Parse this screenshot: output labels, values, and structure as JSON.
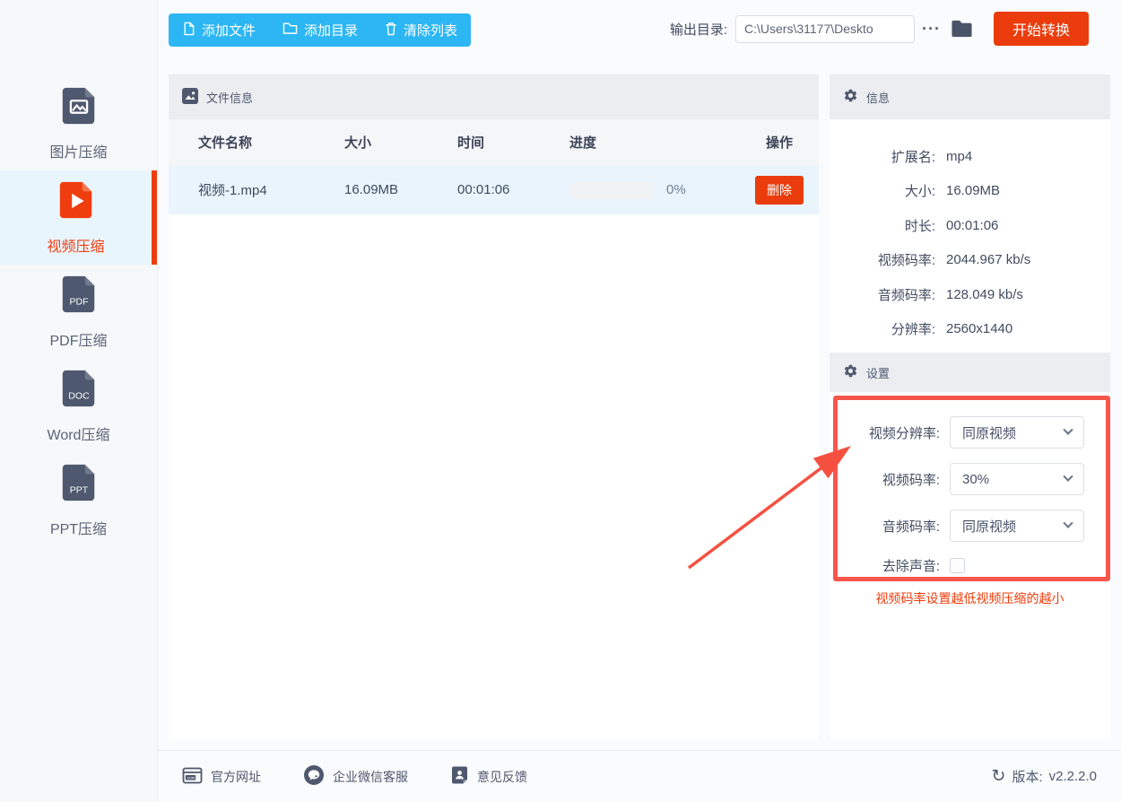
{
  "toolbar": {
    "add_file": "添加文件",
    "add_dir": "添加目录",
    "clear_list": "清除列表",
    "output_label": "输出目录:",
    "output_path": "C:\\Users\\31177\\Deskto",
    "more": "···",
    "start": "开始转换"
  },
  "sidebar": {
    "items": [
      {
        "label": "图片压缩"
      },
      {
        "label": "视频压缩"
      },
      {
        "label": "PDF压缩"
      },
      {
        "label": "Word压缩"
      },
      {
        "label": "PPT压缩"
      }
    ],
    "badges": {
      "pdf": "PDF",
      "doc": "DOC",
      "ppt": "PPT"
    }
  },
  "file_table": {
    "title": "文件信息",
    "headers": [
      "文件名称",
      "大小",
      "时间",
      "进度",
      "操作"
    ],
    "rows": [
      {
        "name": "视频-1.mp4",
        "size": "16.09MB",
        "time": "00:01:06",
        "progress": "0%",
        "action": "删除"
      }
    ]
  },
  "info_panel": {
    "title": "信息",
    "fields": [
      {
        "label": "扩展名:",
        "value": "mp4"
      },
      {
        "label": "大小:",
        "value": "16.09MB"
      },
      {
        "label": "时长:",
        "value": "00:01:06"
      },
      {
        "label": "视频码率:",
        "value": "2044.967 kb/s"
      },
      {
        "label": "音频码率:",
        "value": "128.049 kb/s"
      },
      {
        "label": "分辨率:",
        "value": "2560x1440"
      }
    ]
  },
  "settings_panel": {
    "title": "设置",
    "fields": [
      {
        "label": "视频分辨率:",
        "value": "同原视频"
      },
      {
        "label": "视频码率:",
        "value": "30%"
      },
      {
        "label": "音频码率:",
        "value": "同原视频"
      }
    ],
    "checkbox_label": "去除声音:",
    "checkbox_checked": false,
    "tip": "视频码率设置越低视频压缩的越小"
  },
  "footer": {
    "links": [
      {
        "label": "官方网址"
      },
      {
        "label": "企业微信客服"
      },
      {
        "label": "意见反馈"
      }
    ],
    "version_label": "版本:",
    "version": "v2.2.2.0",
    "refresh": "↻"
  },
  "colors": {
    "accent_blue": "#2cb6f4",
    "accent_red": "#ea3c0c",
    "annotation_red": "#f7564c",
    "slate": "#4e586e",
    "active_bg": "#e9f5fd",
    "row_selected_bg": "#e9f4fd"
  }
}
